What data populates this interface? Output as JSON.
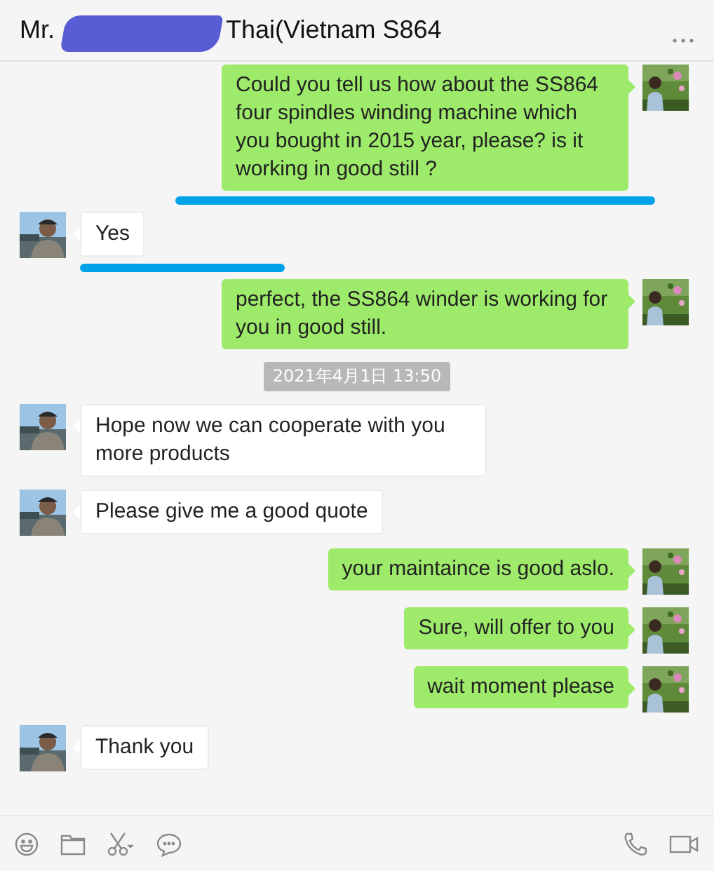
{
  "window": {
    "title_parts": [
      "Mr.",
      "Thai(Vietnam S864"
    ]
  },
  "messages": [
    {
      "kind": "message",
      "outgoing": true,
      "text": "Could you tell us how about the SS864 four spindles winding machine which you bought in 2015 year, please? is it working in good still ?",
      "underlined": true
    },
    {
      "kind": "message",
      "outgoing": false,
      "text": "Yes",
      "underlined": true
    },
    {
      "kind": "message",
      "outgoing": true,
      "text": "perfect, the SS864 winder is working for you in good still.",
      "underlined": false
    },
    {
      "kind": "time",
      "text": "2021年4月1日 13:50"
    },
    {
      "kind": "message",
      "outgoing": false,
      "text": "Hope now we can cooperate with you more products",
      "underlined": false
    },
    {
      "kind": "message",
      "outgoing": false,
      "text": "Please give me a good quote",
      "underlined": false
    },
    {
      "kind": "message",
      "outgoing": true,
      "text": "your maintaince is good aslo.",
      "underlined": false
    },
    {
      "kind": "message",
      "outgoing": true,
      "text": "Sure, will offer to you",
      "underlined": false
    },
    {
      "kind": "message",
      "outgoing": true,
      "text": "wait moment please",
      "underlined": false
    },
    {
      "kind": "message",
      "outgoing": false,
      "text": "Thank you",
      "underlined": false
    }
  ]
}
